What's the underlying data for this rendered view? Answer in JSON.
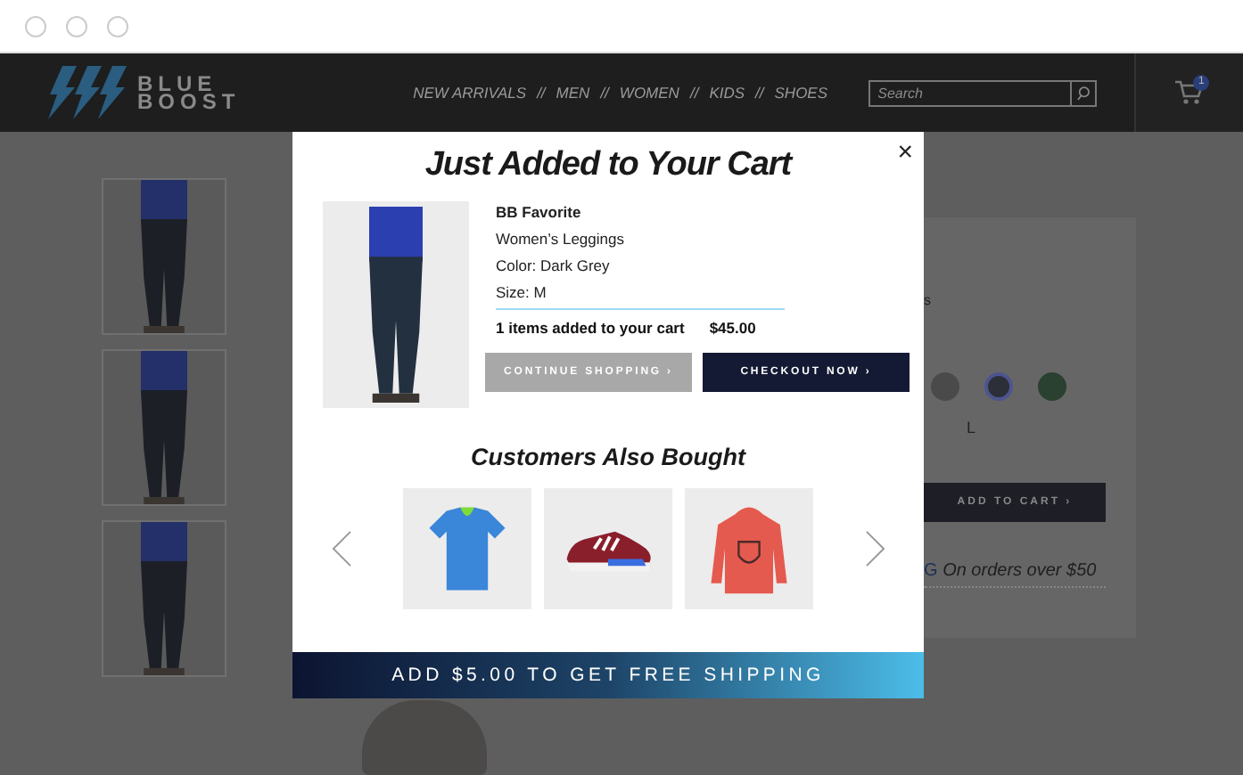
{
  "header": {
    "logo": {
      "line_1": "BLUE",
      "line_2": "BOOST"
    },
    "nav": [
      {
        "label": "NEW ARRIVALS"
      },
      {
        "label": "MEN"
      },
      {
        "label": "WOMEN"
      },
      {
        "label": "KIDS"
      },
      {
        "label": "SHOES"
      }
    ],
    "nav_separator": "//",
    "search": {
      "placeholder": "Search"
    },
    "cart": {
      "badge": "1"
    }
  },
  "product_panel": {
    "partial_text": "s",
    "swatches": [
      {
        "color": "#4a4a4a",
        "selected": false
      },
      {
        "color": "#2c2f37",
        "selected": true
      },
      {
        "color": "#2a4030",
        "selected": false
      }
    ],
    "sizes": [
      "L"
    ],
    "add_to_cart": "ADD TO CART ›",
    "promo_lead": "G",
    "promo": "On orders over $50"
  },
  "modal": {
    "title": "Just Added to Your Cart",
    "close": "×",
    "product": {
      "name": "BB Favorite",
      "lines": [
        "Women’s Leggings",
        "Color: Dark Grey",
        "Size: M"
      ]
    },
    "summary": "1 items added to your cart",
    "total": "$45.00",
    "buttons": [
      {
        "label": "CONTINUE SHOPPING ›",
        "kind": "secondary"
      },
      {
        "label": "CHECKOUT NOW ›",
        "kind": "primary"
      }
    ],
    "also_bought": {
      "title": "Customers Also Bought",
      "items": [
        {
          "kind": "tshirt"
        },
        {
          "kind": "sneaker"
        },
        {
          "kind": "hoodie"
        }
      ]
    },
    "banner": "ADD $5.00 TO GET FREE SHIPPING"
  }
}
